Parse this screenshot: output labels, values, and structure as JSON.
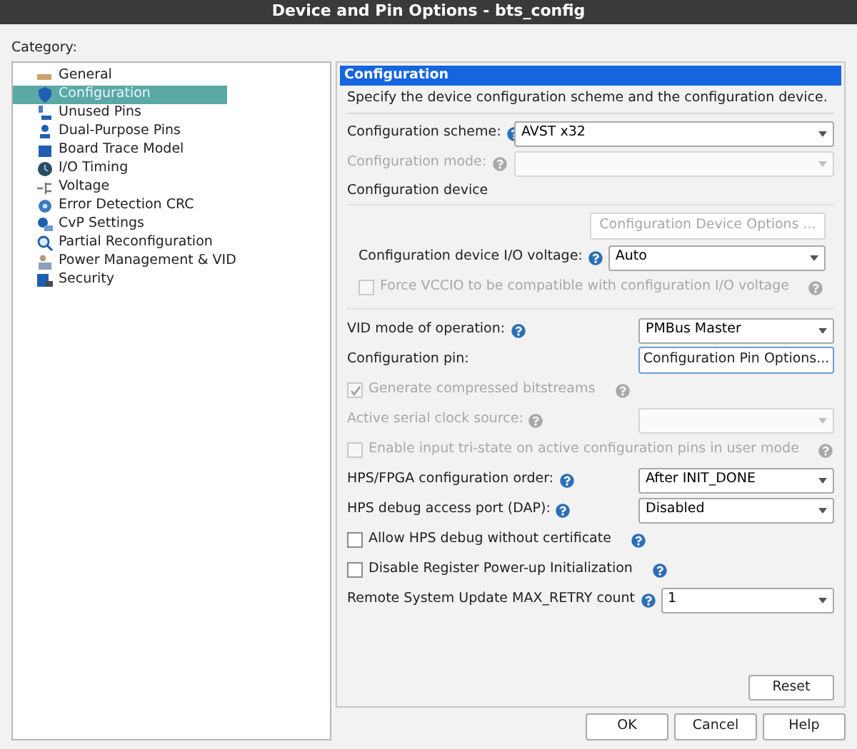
{
  "window": {
    "title": "Device and Pin Options - bts_config"
  },
  "category_label": "Category:",
  "categories": [
    {
      "label": "General",
      "selected": false
    },
    {
      "label": "Configuration",
      "selected": true
    },
    {
      "label": "Unused Pins",
      "selected": false
    },
    {
      "label": "Dual-Purpose Pins",
      "selected": false
    },
    {
      "label": "Board Trace Model",
      "selected": false
    },
    {
      "label": "I/O Timing",
      "selected": false
    },
    {
      "label": "Voltage",
      "selected": false
    },
    {
      "label": "Error Detection CRC",
      "selected": false
    },
    {
      "label": "CvP Settings",
      "selected": false
    },
    {
      "label": "Partial Reconfiguration",
      "selected": false
    },
    {
      "label": "Power Management & VID",
      "selected": false
    },
    {
      "label": "Security",
      "selected": false
    }
  ],
  "panel": {
    "title": "Configuration",
    "description": "Specify the device configuration scheme and the configuration device.",
    "rows": [
      {
        "kind": "select_wide",
        "label": "Configuration scheme:",
        "value": "AVST x32",
        "disabled": false
      },
      {
        "kind": "select_wide",
        "label": "Configuration mode:",
        "disabled": true
      },
      {
        "kind": "group",
        "label": "Configuration device",
        "children": [
          {
            "kind": "button",
            "label": "Configuration Device Options ...",
            "disabled": true
          },
          {
            "kind": "select_inline",
            "label": "Configuration device I/O voltage:",
            "value": "Auto",
            "disabled": false
          },
          {
            "kind": "checkbox",
            "label": "Force VCCIO to be compatible with configuration I/O voltage",
            "checked": false,
            "disabled": true
          }
        ]
      },
      {
        "kind": "select",
        "label": "VID mode of operation:",
        "value": "PMBus Master",
        "disabled": false
      },
      {
        "kind": "button",
        "label": "Configuration pin:",
        "button": "Configuration Pin Options...",
        "disabled": false
      },
      {
        "kind": "checkbox",
        "label": "Generate compressed bitstreams",
        "checked": true,
        "disabled": true
      },
      {
        "kind": "select",
        "label": "Active serial clock source:",
        "disabled": true
      },
      {
        "kind": "checkbox",
        "label": "Enable input tri-state on active configuration pins in user mode",
        "checked": false,
        "disabled": true
      },
      {
        "kind": "select",
        "label": "HPS/FPGA configuration order:",
        "value": "After INIT_DONE",
        "disabled": false
      },
      {
        "kind": "select",
        "label": "HPS debug access port (DAP):",
        "value": "Disabled",
        "disabled": false
      },
      {
        "kind": "checkbox",
        "label": "Allow HPS debug without certificate",
        "checked": false,
        "disabled": false
      },
      {
        "kind": "checkbox",
        "label": "Disable Register Power-up Initialization",
        "checked": false,
        "disabled": false
      },
      {
        "kind": "select_inline",
        "label": "Remote System Update MAX_RETRY count",
        "value": "1",
        "disabled": false
      }
    ],
    "reset": "Reset"
  },
  "buttons": [
    "OK",
    "Cancel",
    "Help"
  ]
}
